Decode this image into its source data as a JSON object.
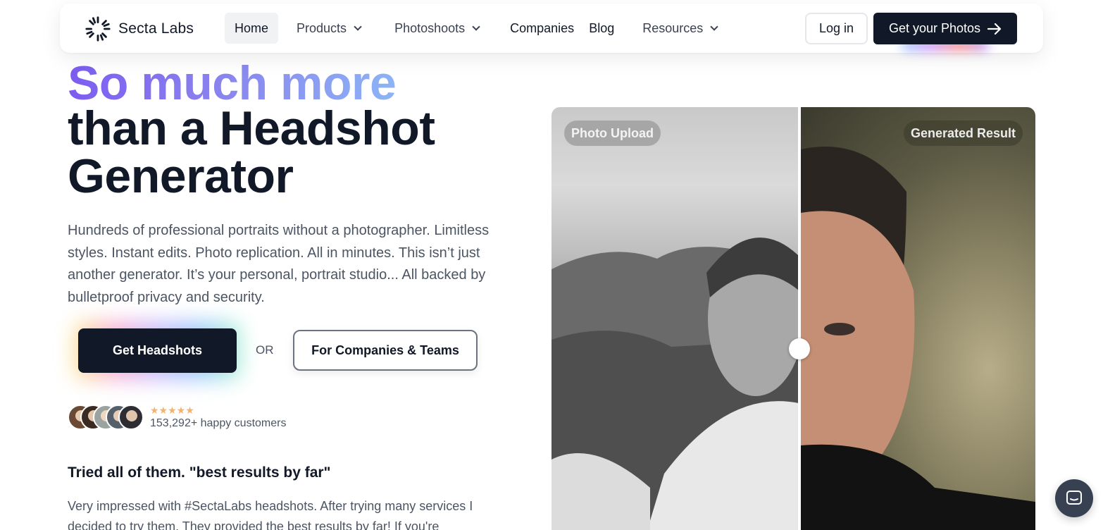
{
  "nav": {
    "logo_text": "Secta Labs",
    "links": [
      {
        "label": "Home",
        "active": true
      },
      {
        "label": "Products",
        "has_dropdown": true
      },
      {
        "label": "Photoshoots",
        "has_dropdown": true
      },
      {
        "label": "Companies"
      },
      {
        "label": "Blog"
      },
      {
        "label": "Resources",
        "has_dropdown": true
      }
    ],
    "login_label": "Log in",
    "cta_label": "Get your Photos"
  },
  "hero": {
    "headline_gradient": "So much more",
    "headline_line2": "than a Headshot",
    "headline_line3": "Generator",
    "subtitle": "Hundreds of professional portraits without a photographer. Limitless styles. Instant edits. Photo replication. All in minutes. This isn’t just another generator. It’s your personal, portrait studio... All backed by bulletproof privacy and security.",
    "primary_button": "Get Headshots",
    "or_label": "OR",
    "secondary_button": "For Companies & Teams",
    "rating_stars": "★★★★★",
    "customers": "153,292+ happy customers",
    "gradient_colors": [
      "#7c5cf0",
      "#8cb4f5"
    ]
  },
  "testimonial": {
    "title": "Tried all of them. \"best results by far\"",
    "body": "Very impressed with #SectaLabs headshots. After trying many services I decided to try them. They provided the best results by far! If you're"
  },
  "comparison": {
    "left_label": "Photo Upload",
    "right_label": "Generated Result"
  },
  "icons": [
    "secta-logo-icon",
    "chevron-down-icon",
    "arrow-right-icon",
    "chat-icon"
  ],
  "colors": {
    "primary": "#111827",
    "text_muted": "#4b5563",
    "star": "#f6b26b"
  }
}
